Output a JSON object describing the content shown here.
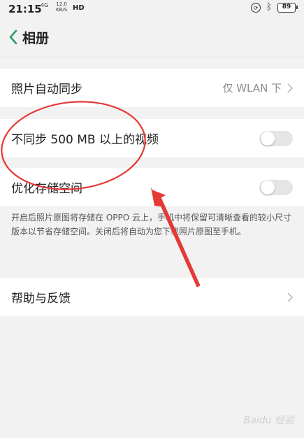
{
  "status_bar": {
    "time": "21:15",
    "signal": "4G",
    "net_speed_value": "12.0",
    "net_speed_unit": "KB/S",
    "hd": "HD",
    "battery": "89"
  },
  "header": {
    "title": "相册"
  },
  "rows": {
    "auto_sync": {
      "label": "照片自动同步",
      "value": "仅 WLAN 下"
    },
    "skip_video": {
      "label": "不同步 500 MB 以上的视频",
      "enabled": false
    },
    "optimize": {
      "label": "优化存储空间",
      "enabled": false
    },
    "help": {
      "label": "帮助与反馈"
    }
  },
  "optimize_description": "开启后照片原图将存储在 OPPO 云上，手机中将保留可清晰查看的较小尺寸版本以节省存储空间。关闭后将自动为您下载照片原图至手机。",
  "watermark": "Baidu 经验",
  "colors": {
    "annotation": "#e53935",
    "background": "#f2f2f2"
  }
}
